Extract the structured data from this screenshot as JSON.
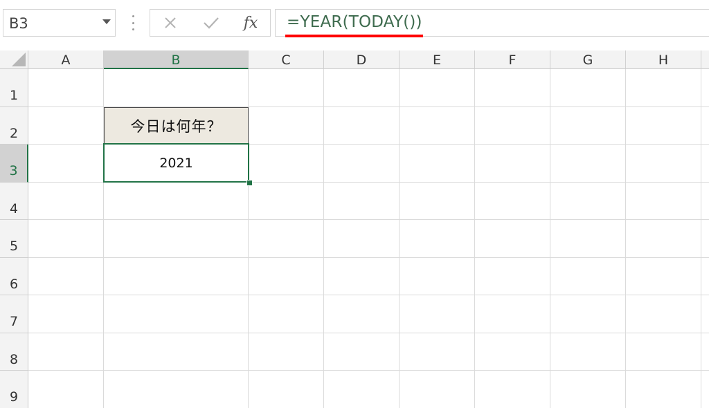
{
  "name_box": {
    "value": "B3"
  },
  "formula_bar": {
    "formula": "=YEAR(TODAY())",
    "fx_label": "fx",
    "icons": {
      "cancel": "close-icon",
      "enter": "check-icon",
      "function": "fx-icon"
    }
  },
  "columns": [
    "A",
    "B",
    "C",
    "D",
    "E",
    "F",
    "G",
    "H"
  ],
  "rows": [
    "1",
    "2",
    "3",
    "4",
    "5",
    "6",
    "7",
    "8",
    "9"
  ],
  "active_cell": {
    "column": "B",
    "row": "3"
  },
  "cells": {
    "B2": "今日は何年？",
    "B3": "2021"
  },
  "colors": {
    "accent": "#217346",
    "header_cell_fill": "#ede9e0",
    "formula_underline": "#ff0000"
  }
}
